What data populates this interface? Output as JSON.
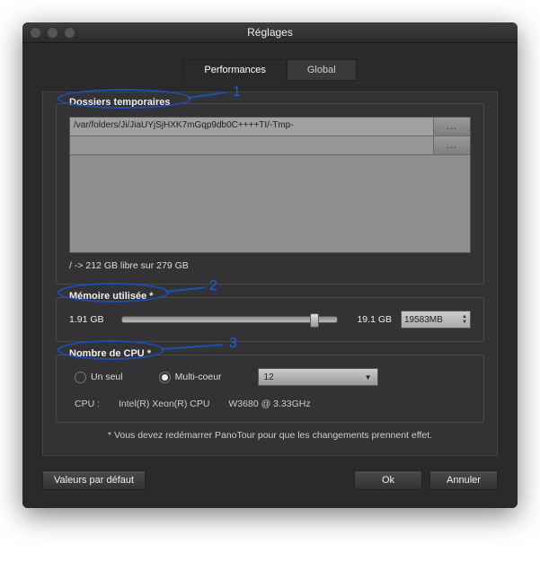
{
  "window": {
    "title": "Réglages"
  },
  "tabs": {
    "performances": "Performances",
    "global": "Global"
  },
  "sections": {
    "temp_folders": {
      "title": "Dossiers temporaires",
      "rows": [
        {
          "path": "/var/folders/Ji/JiaUYjSjHXK7mGqp9db0C++++TI/-Tmp-",
          "btn": "..."
        },
        {
          "path": "",
          "btn": "..."
        }
      ],
      "disk_free": "/ -> 212 GB libre sur 279 GB"
    },
    "memory": {
      "title": "Mémoire utilisée *",
      "min": "1.91 GB",
      "max": "19.1 GB",
      "value": "19583MB"
    },
    "cpu": {
      "title": "Nombre de CPU *",
      "single": "Un seul",
      "multi": "Multi-coeur",
      "count": "12",
      "label": "CPU :",
      "model": "Intel(R) Xeon(R) CPU",
      "spec": "W3680  @ 3.33GHz"
    }
  },
  "restart_note": "* Vous devez redémarrer PanoTour pour que les changements prennent effet.",
  "footer": {
    "defaults": "Valeurs par défaut",
    "ok": "Ok",
    "cancel": "Annuler"
  },
  "annotations": {
    "n1": "1",
    "n2": "2",
    "n3": "3"
  }
}
